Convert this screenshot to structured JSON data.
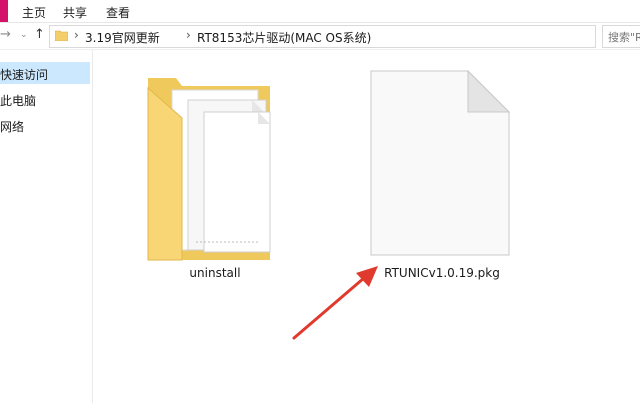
{
  "ribbon": {
    "tabs": [
      "主页",
      "共享",
      "查看"
    ]
  },
  "address": {
    "crumbs": [
      "3.19官网更新",
      "RT8153芯片驱动(MAC OS系统)"
    ],
    "search_placeholder": "搜索\"R"
  },
  "sidebar": {
    "items": [
      {
        "label": "快速访问",
        "selected": true
      },
      {
        "label": "此电脑",
        "selected": false
      },
      {
        "label": "网络",
        "selected": false
      }
    ]
  },
  "files": [
    {
      "name": "uninstall",
      "icon": "folder-icon"
    },
    {
      "name": "RTUNICv1.0.19.pkg",
      "icon": "file-icon"
    }
  ],
  "colors": {
    "file_tab": "#d4116b",
    "selection": "#cce8ff",
    "folder": "#f3ce6b",
    "annotation_arrow": "#e03a2f"
  }
}
